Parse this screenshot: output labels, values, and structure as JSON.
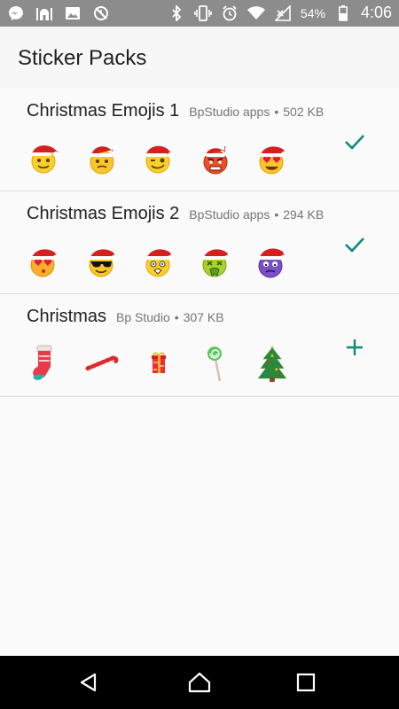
{
  "status_bar": {
    "left_icons": [
      "messenger-icon",
      "mosque-icon",
      "image-icon",
      "no-sync-icon"
    ],
    "right_icons": [
      "bluetooth-icon",
      "vibrate-icon",
      "alarm-icon",
      "wifi-icon",
      "signal-icon",
      "battery-icon"
    ],
    "battery": "54%",
    "time": "4:06"
  },
  "app_bar": {
    "title": "Sticker Packs"
  },
  "packs": [
    {
      "name": "Christmas Emojis 1",
      "publisher": "BpStudio apps",
      "separator": "•",
      "size": "502 KB",
      "action": "check-icon",
      "accent": "#0f8a78",
      "stickers": [
        "santa-hat-smiling-emoji",
        "santa-hat-worried-emoji",
        "santa-hat-winking-emoji",
        "angry-red-emoji",
        "heart-eyes-santa-emoji"
      ]
    },
    {
      "name": "Christmas Emojis 2",
      "publisher": "BpStudio apps",
      "separator": "•",
      "size": "294 KB",
      "action": "check-icon",
      "accent": "#0f8a78",
      "stickers": [
        "heart-eyes-santa-emoji",
        "sunglasses-santa-emoji",
        "santa-hat-blushing-emoji",
        "sick-green-santa-emoji",
        "purple-grumpy-santa-emoji"
      ]
    },
    {
      "name": "Christmas",
      "publisher": "Bp Studio",
      "separator": "•",
      "size": "307 KB",
      "action": "plus-icon",
      "accent": "#0f8a78",
      "stickers": [
        "stocking-sticker",
        "candy-cane-sticker",
        "gift-box-sticker",
        "lollipop-sticker",
        "christmas-tree-sticker"
      ]
    }
  ],
  "nav_bar": {
    "icons": [
      "back-icon",
      "home-icon",
      "recents-icon"
    ]
  }
}
